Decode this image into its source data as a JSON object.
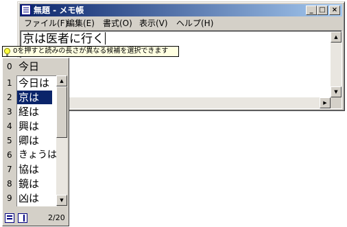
{
  "window": {
    "title": "無題 - メモ帳",
    "buttons": {
      "minimize": "_",
      "maximize": "□",
      "close": "×"
    }
  },
  "menu": [
    {
      "label": "ファイル(F)"
    },
    {
      "label": "編集(E)"
    },
    {
      "label": "書式(O)"
    },
    {
      "label": "表示(V)"
    },
    {
      "label": "ヘルプ(H)"
    }
  ],
  "editor": {
    "converted": "京は",
    "composing": "医者に行く"
  },
  "hint": {
    "icon": "lightbulb-icon",
    "text": "0を押すと読みの長さが異なる候補を選択できます"
  },
  "candidates": {
    "top": {
      "number": "0",
      "text": "今日"
    },
    "items": [
      {
        "number": "1",
        "text": "今日は"
      },
      {
        "number": "2",
        "text": "京は"
      },
      {
        "number": "3",
        "text": "経は"
      },
      {
        "number": "4",
        "text": "興は"
      },
      {
        "number": "5",
        "text": "卿は"
      },
      {
        "number": "6",
        "text": "きょうは"
      },
      {
        "number": "7",
        "text": "協は"
      },
      {
        "number": "8",
        "text": "鏡は"
      },
      {
        "number": "9",
        "text": "凶は"
      }
    ],
    "selected_index": 1,
    "page": "2/20",
    "colors": {
      "selection": "#0a246a",
      "selection_text": "#ffffff"
    }
  }
}
